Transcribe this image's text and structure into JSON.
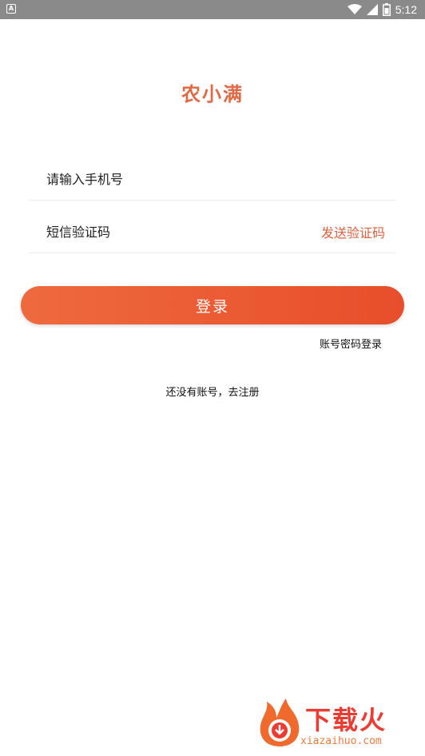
{
  "status_bar": {
    "time": "5:12"
  },
  "brand": {
    "title": "农小满"
  },
  "phone_field": {
    "placeholder": "请输入手机号"
  },
  "sms_field": {
    "placeholder": "短信验证码",
    "send_code_label": "发送验证码"
  },
  "login_button": {
    "label": "登录"
  },
  "password_login_link": {
    "label": "账号密码登录"
  },
  "register_link": {
    "label": "还没有账号，去注册"
  },
  "watermark": {
    "text": "下载火",
    "url": "xiazaihuo.com"
  },
  "colors": {
    "accent": "#e84e2b",
    "brand": "#e06a45",
    "status_bar": "#8a8a8a"
  }
}
